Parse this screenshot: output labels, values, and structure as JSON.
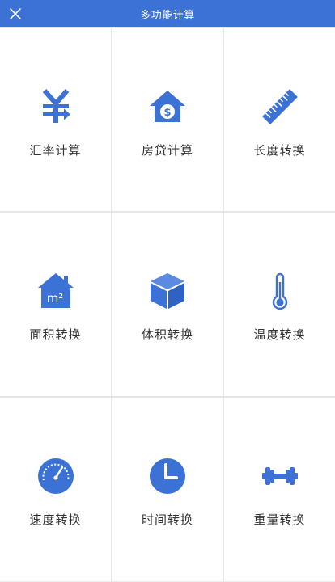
{
  "header": {
    "title": "多功能计算",
    "close_icon": "close-icon"
  },
  "accent_color": "#3c72d6",
  "tools": [
    {
      "label": "汇率计算",
      "icon": "yuan-exchange-icon"
    },
    {
      "label": "房贷计算",
      "icon": "house-dollar-icon"
    },
    {
      "label": "长度转换",
      "icon": "ruler-icon"
    },
    {
      "label": "面积转换",
      "icon": "house-m2-icon"
    },
    {
      "label": "体积转换",
      "icon": "cube-icon"
    },
    {
      "label": "温度转换",
      "icon": "thermometer-icon"
    },
    {
      "label": "速度转换",
      "icon": "speedometer-icon"
    },
    {
      "label": "时间转换",
      "icon": "clock-icon"
    },
    {
      "label": "重量转换",
      "icon": "dumbbell-icon"
    }
  ],
  "icon_text": {
    "area_unit": "m²"
  }
}
